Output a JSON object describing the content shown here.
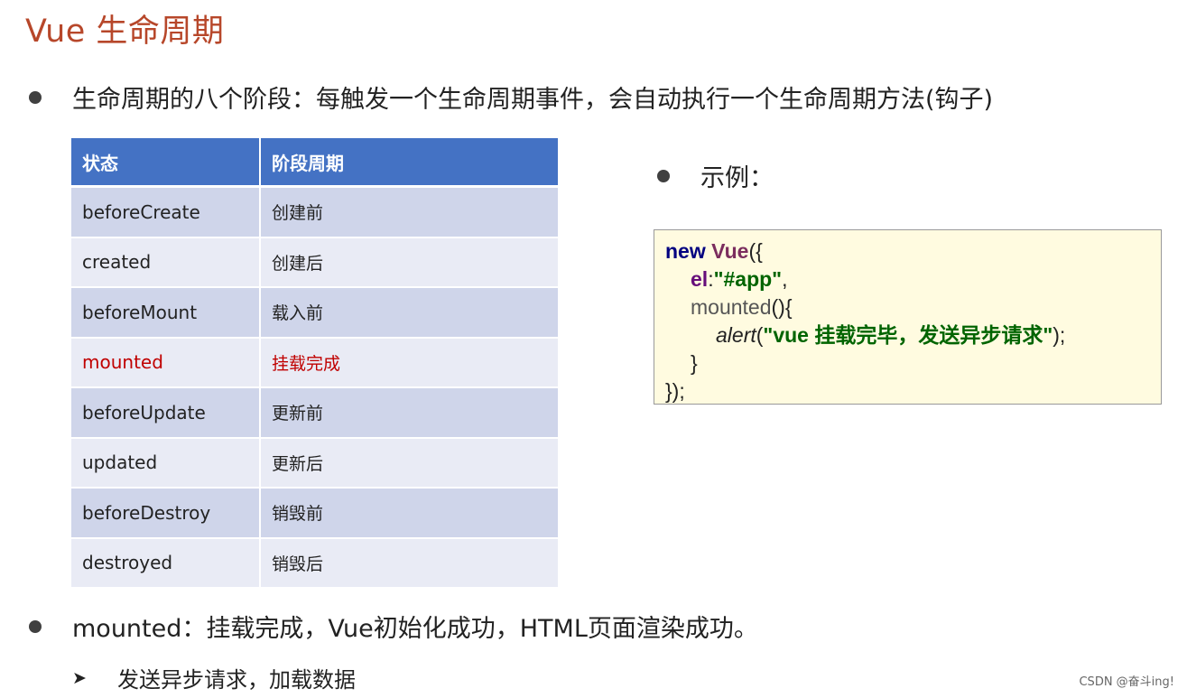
{
  "title": "Vue 生命周期",
  "bullet1": "生命周期的八个阶段：每触发一个生命周期事件，会自动执行一个生命周期方法(钩子)",
  "table": {
    "headers": [
      "状态",
      "阶段周期"
    ],
    "rows": [
      {
        "state": "beforeCreate",
        "phase": "创建前",
        "highlight": false
      },
      {
        "state": "created",
        "phase": "创建后",
        "highlight": false
      },
      {
        "state": "beforeMount",
        "phase": "载入前",
        "highlight": false
      },
      {
        "state": "mounted",
        "phase": "挂载完成",
        "highlight": true
      },
      {
        "state": "beforeUpdate",
        "phase": "更新前",
        "highlight": false
      },
      {
        "state": "updated",
        "phase": "更新后",
        "highlight": false
      },
      {
        "state": "beforeDestroy",
        "phase": "销毁前",
        "highlight": false
      },
      {
        "state": "destroyed",
        "phase": "销毁后",
        "highlight": false
      }
    ]
  },
  "example_label": "示例：",
  "code": {
    "new_kw": "new",
    "vue_kw": "Vue",
    "open": "({",
    "el_key": "el",
    "colon": ":",
    "el_value": "\"#app\"",
    "comma": ",",
    "mounted_fn": "mounted",
    "mounted_open": "(){",
    "alert_fn": "alert",
    "paren_open": "(",
    "alert_str": "\"vue 挂载完毕，发送异步请求\"",
    "paren_close": ");",
    "inner_close": "}",
    "outer_close": "});"
  },
  "bullet3": "mounted：挂载完成，Vue初始化成功，HTML页面渲染成功。",
  "sub_bullet": "发送异步请求，加载数据",
  "watermark": "CSDN @奋斗ing!",
  "colors": {
    "title": "#b7472a",
    "table_header": "#4472c4",
    "row_odd": "#cfd5ea",
    "row_even": "#e9ebf5",
    "highlight_text": "#c00000",
    "code_bg": "#fffbe0"
  }
}
